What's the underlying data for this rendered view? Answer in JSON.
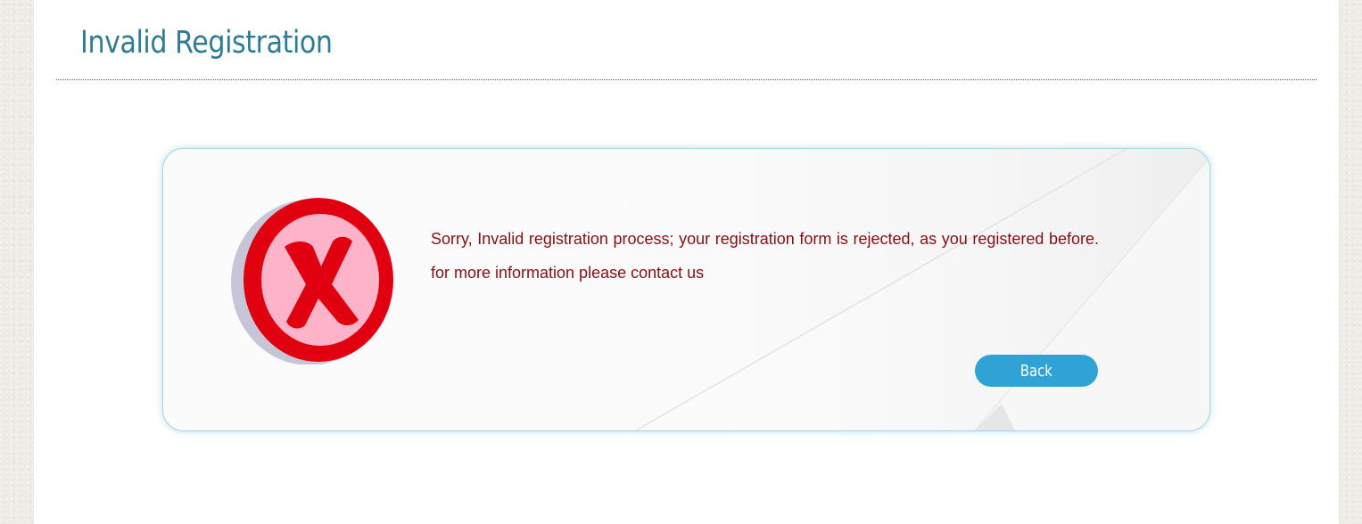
{
  "page": {
    "title": "Invalid Registration"
  },
  "alert": {
    "icon": "error-x-icon",
    "message": "Sorry, Invalid registration process; your registration form is rejected, as you registered before. for more information please contact us",
    "back_label": "Back"
  },
  "colors": {
    "title": "#2e7d95",
    "message": "#8b0d12",
    "button": "#2fa3d6",
    "icon_ring": "#e0000f",
    "icon_fill": "#ffb3c8",
    "icon_shadow": "#c7c6d8"
  }
}
